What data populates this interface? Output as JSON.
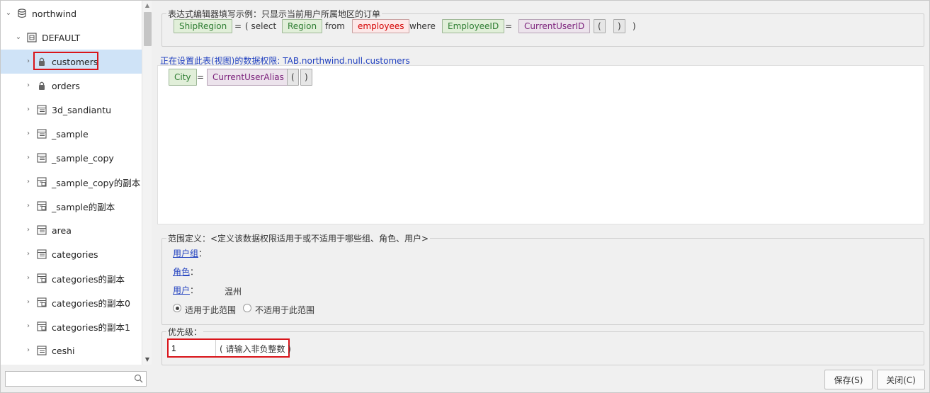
{
  "tree": {
    "root": "northwind",
    "schema": "DEFAULT",
    "items": [
      {
        "label": "customers",
        "icon": "lock-icon"
      },
      {
        "label": "orders",
        "icon": "lock-icon"
      },
      {
        "label": "3d_sandiantu",
        "icon": "table-icon"
      },
      {
        "label": "_sample",
        "icon": "table-icon"
      },
      {
        "label": "_sample_copy",
        "icon": "table-icon"
      },
      {
        "label": "_sample_copy的副本",
        "icon": "copy-table-icon"
      },
      {
        "label": "_sample的副本",
        "icon": "copy-table-icon"
      },
      {
        "label": "area",
        "icon": "table-icon"
      },
      {
        "label": "categories",
        "icon": "table-icon"
      },
      {
        "label": "categories的副本",
        "icon": "copy-table-icon"
      },
      {
        "label": "categories的副本0",
        "icon": "copy-table-icon"
      },
      {
        "label": "categories的副本1",
        "icon": "copy-table-icon"
      },
      {
        "label": "ceshi",
        "icon": "table-icon"
      }
    ],
    "search_value": ""
  },
  "example": {
    "legend": "表达式编辑器填写示例：只显示当前用户所属地区的订单",
    "tokens": {
      "shipregion": "ShipRegion",
      "eq1": "=",
      "open_select": "( select",
      "region": "Region",
      "from": "from",
      "employees": "employees",
      "where": "where",
      "employeeid": "EmployeeID",
      "eq2": "=",
      "currentuserid": "CurrentUserID",
      "lparen": "(",
      "rparen": ")",
      "close": ")"
    }
  },
  "permission": {
    "label": "正在设置此表(视图)的数据权限: TAB.northwind.null.customers",
    "expr": {
      "city": "City",
      "eq": "=",
      "func": "CurrentUserAlias",
      "lparen": "(",
      "rparen": ")"
    }
  },
  "scope": {
    "legend": "范围定义：<定义该数据权限适用于或不适用于哪些组、角色、用户>",
    "usergroup_link": "用户组",
    "role_link": "角色",
    "user_link": "用户",
    "colon": "：",
    "user_value": "温州",
    "apply_label": "适用于此范围",
    "not_apply_label": "不适用于此范围",
    "selected": "apply"
  },
  "priority": {
    "legend": "优先级：",
    "value": "1",
    "hint": "( 请输入非负整数 )"
  },
  "buttons": {
    "save": "保存(S)",
    "close": "关闭(C)"
  },
  "colors": {
    "selected_row": "#cfe3f7",
    "highlight_red": "#d9141a",
    "link_blue": "#1f3fbf",
    "field_green": "#2e7d32",
    "func_purple": "#7a1f7a",
    "table_red": "#d40000"
  }
}
